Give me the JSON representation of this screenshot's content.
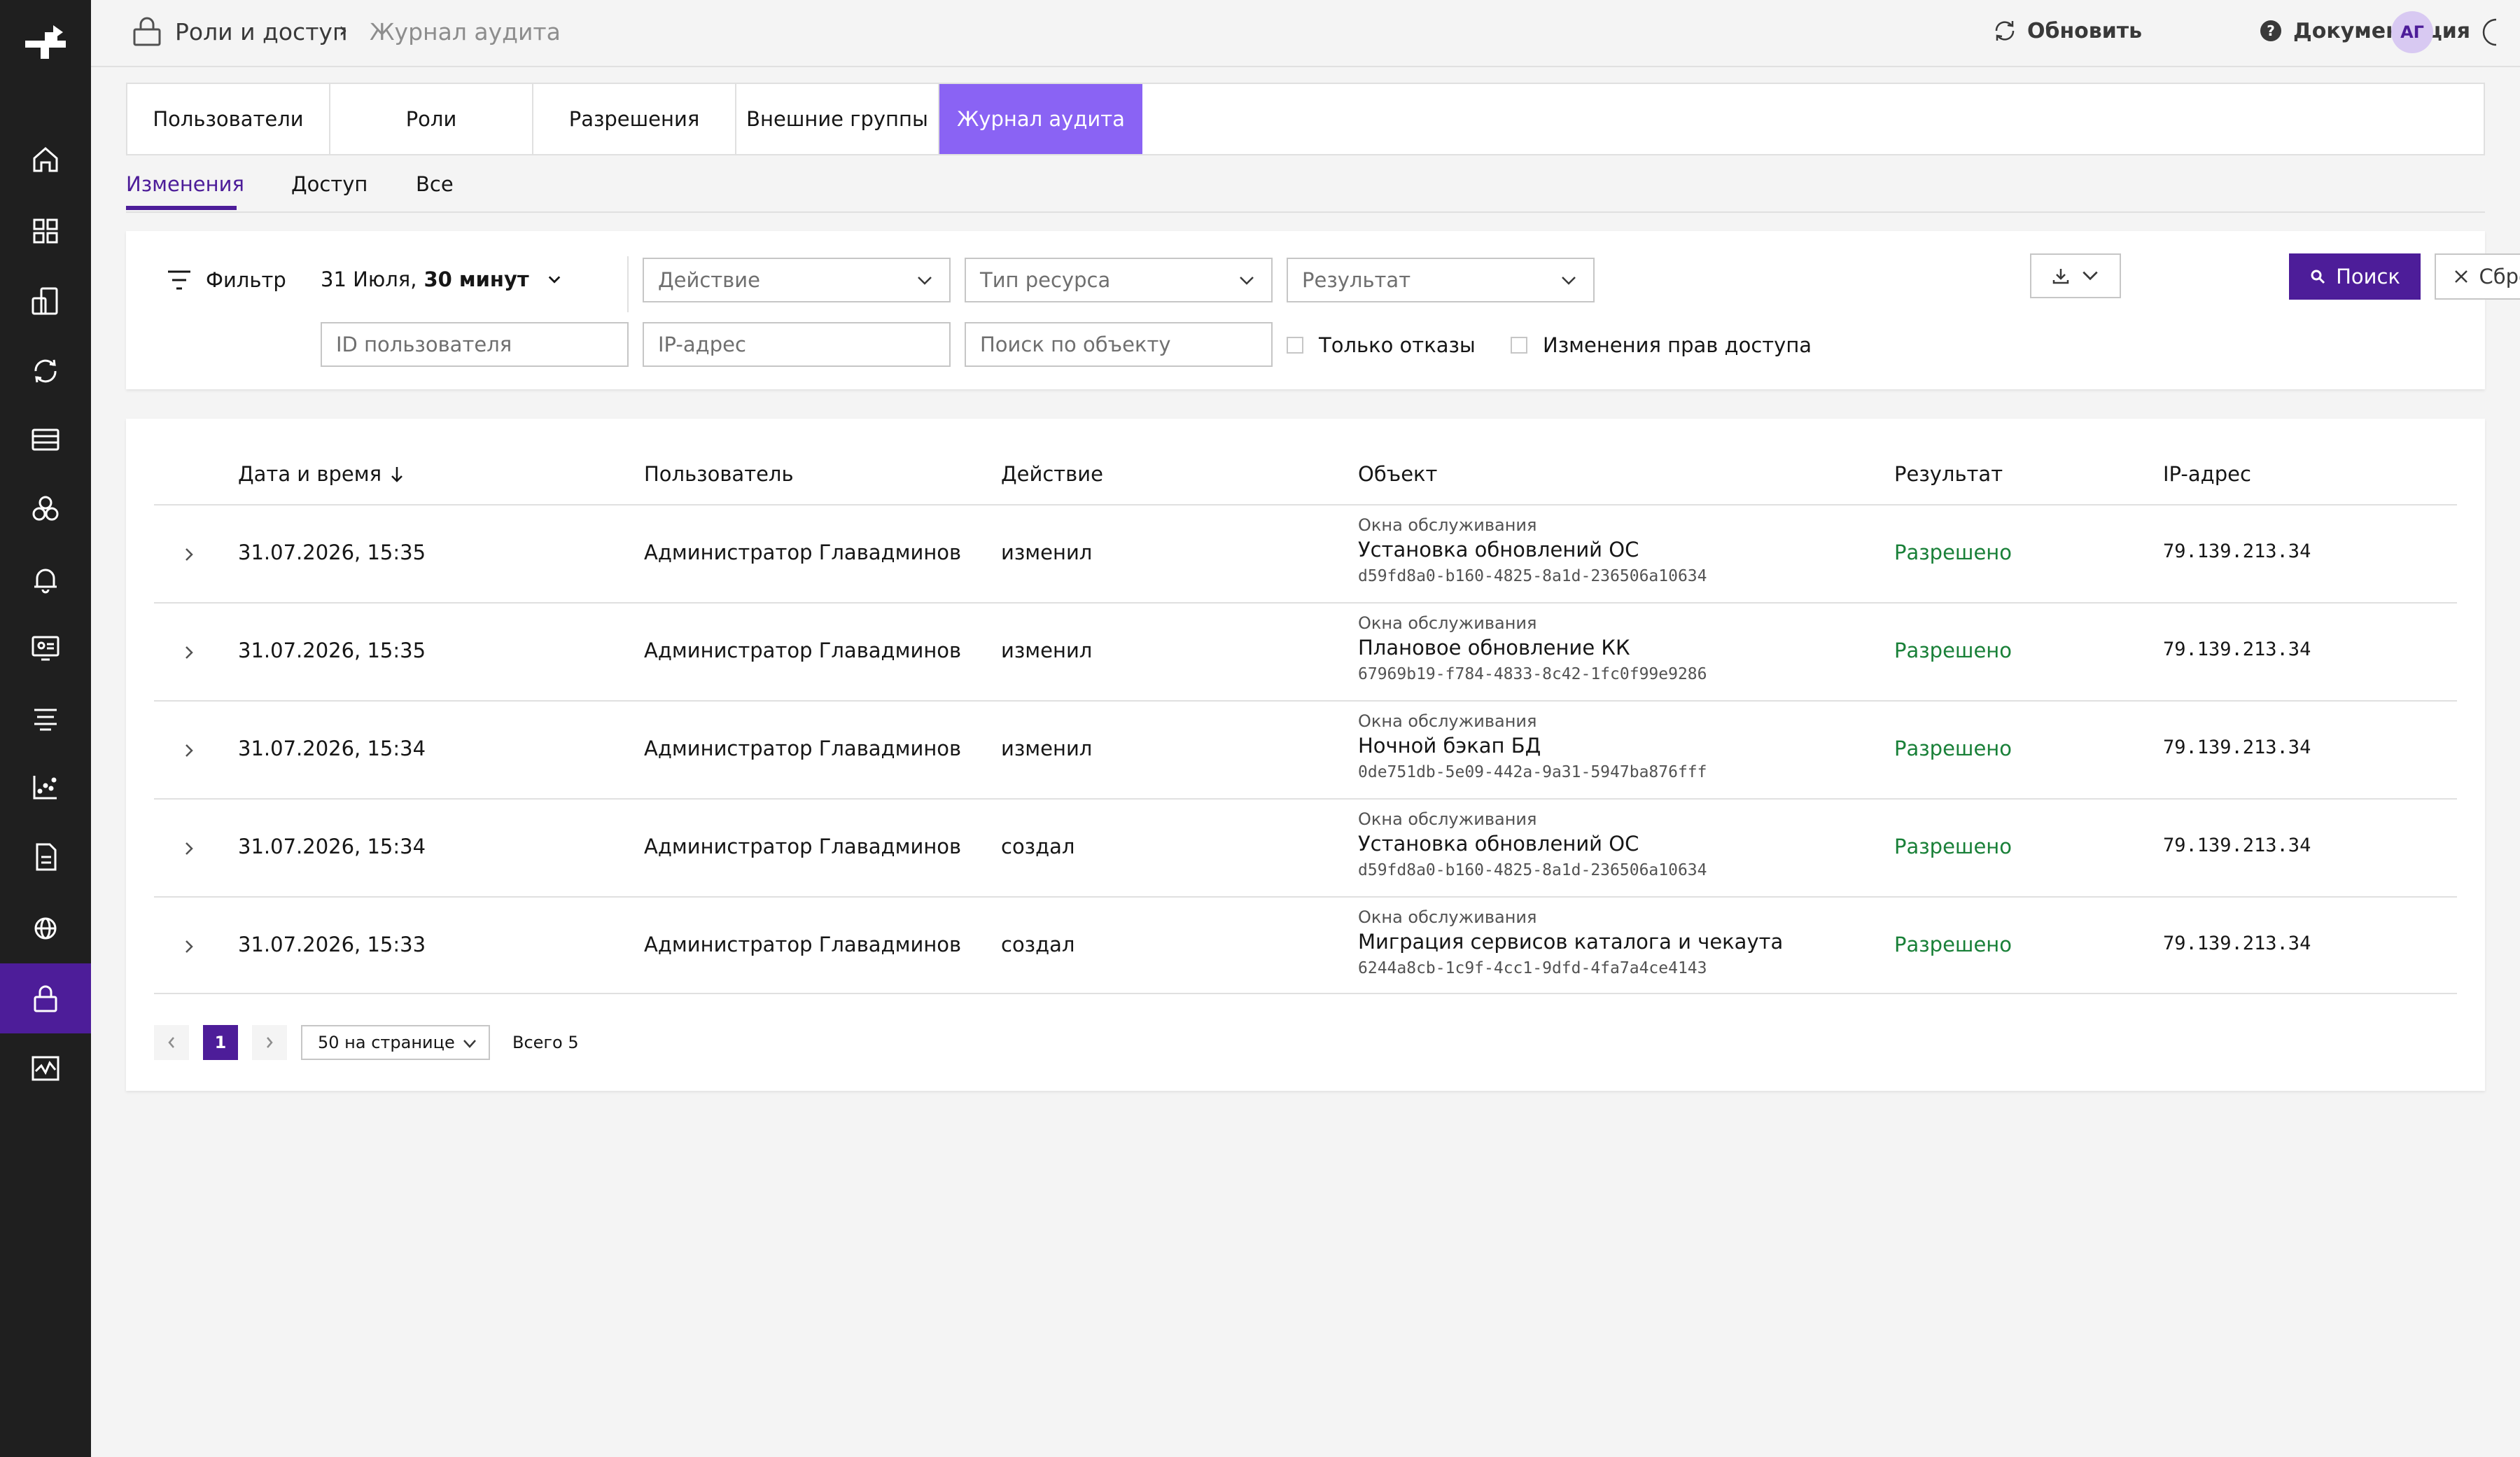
{
  "header": {
    "breadcrumb_root": "Роли и доступ",
    "breadcrumb_current": "Журнал аудита",
    "refresh_label": "Обновить",
    "docs_label": "Документация",
    "avatar_initials": "АГ"
  },
  "tabs": [
    "Пользователи",
    "Роли",
    "Разрешения",
    "Внешние группы",
    "Журнал аудита"
  ],
  "subtabs": [
    "Изменения",
    "Доступ",
    "Все"
  ],
  "filter": {
    "label": "Фильтр",
    "date_prefix": "31 Июля,",
    "date_range": "30 минут",
    "action_placeholder": "Действие",
    "resource_type_placeholder": "Тип ресурса",
    "result_placeholder": "Результат",
    "user_id_placeholder": "ID пользователя",
    "ip_placeholder": "IP-адрес",
    "object_search_placeholder": "Поиск по объекту",
    "only_denials_label": "Только отказы",
    "access_changes_label": "Изменения прав доступа",
    "search_button": "Поиск",
    "reset_button": "Сбросить"
  },
  "table": {
    "columns": {
      "datetime": "Дата и время",
      "user": "Пользователь",
      "action": "Действие",
      "object": "Объект",
      "result": "Результат",
      "ip": "IP-адрес"
    },
    "rows": [
      {
        "datetime": "31.07.2026, 15:35",
        "user": "Администратор Главадминов",
        "action": "изменил",
        "object_type": "Окна обслуживания",
        "object_name": "Установка обновлений ОС",
        "object_id": "d59fd8a0-b160-4825-8a1d-236506a10634",
        "result": "Разрешено",
        "ip": "79.139.213.34"
      },
      {
        "datetime": "31.07.2026, 15:35",
        "user": "Администратор Главадминов",
        "action": "изменил",
        "object_type": "Окна обслуживания",
        "object_name": "Плановое обновление КК",
        "object_id": "67969b19-f784-4833-8c42-1fc0f99e9286",
        "result": "Разрешено",
        "ip": "79.139.213.34"
      },
      {
        "datetime": "31.07.2026, 15:34",
        "user": "Администратор Главадминов",
        "action": "изменил",
        "object_type": "Окна обслуживания",
        "object_name": "Ночной бэкап БД",
        "object_id": "0de751db-5e09-442a-9a31-5947ba876fff",
        "result": "Разрешено",
        "ip": "79.139.213.34"
      },
      {
        "datetime": "31.07.2026, 15:34",
        "user": "Администратор Главадминов",
        "action": "создал",
        "object_type": "Окна обслуживания",
        "object_name": "Установка обновлений ОС",
        "object_id": "d59fd8a0-b160-4825-8a1d-236506a10634",
        "result": "Разрешено",
        "ip": "79.139.213.34"
      },
      {
        "datetime": "31.07.2026, 15:33",
        "user": "Администратор Главадминов",
        "action": "создал",
        "object_type": "Окна обслуживания",
        "object_name": "Миграция сервисов каталога и чекаута",
        "object_id": "6244a8cb-1c9f-4cc1-9dfd-4fa7a4ce4143",
        "result": "Разрешено",
        "ip": "79.139.213.34"
      }
    ]
  },
  "pagination": {
    "current_page": "1",
    "page_size": "50 на странице",
    "total": "Всего 5"
  },
  "colors": {
    "accent": "#4d1d99",
    "active_tab": "#8a63f4",
    "success": "#198038",
    "sidebar": "#1f1f1f"
  },
  "icons": [
    "logo-icon",
    "home-icon",
    "grid-icon",
    "devices-icon",
    "sync-icon",
    "server-icon",
    "hexagons-icon",
    "bell-icon",
    "monitor-icon",
    "stack-icon",
    "chart-icon",
    "document-icon",
    "network-icon",
    "lock-icon",
    "activity-icon"
  ]
}
